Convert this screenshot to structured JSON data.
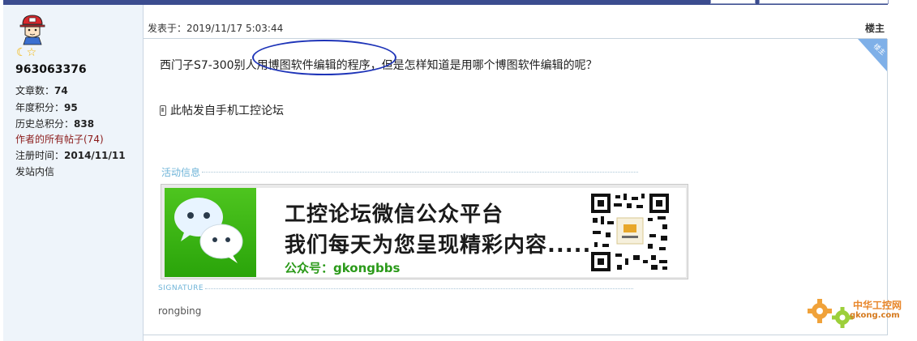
{
  "user": {
    "name": "963063376",
    "stats": [
      {
        "label": "文章数：",
        "value": "74"
      },
      {
        "label": "年度积分：",
        "value": "95"
      },
      {
        "label": "历史总积分：",
        "value": "838"
      }
    ],
    "all_posts_link": "作者的所有帖子(74)",
    "register": {
      "label": "注册时间：",
      "value": "2014/11/11"
    },
    "message_link": "发站内信"
  },
  "post": {
    "time": "发表于：2019/11/17 5:03:44",
    "floor": "楼主",
    "corner_label": "楼主",
    "text": "西门子S7-300别人用博图软件编辑的程序，但是怎样知道是用哪个博图软件编辑的呢？",
    "mobile_note": "此帖发自手机工控论坛"
  },
  "activity": {
    "label": "活动信息",
    "banner_line1": "工控论坛微信公众平台",
    "banner_line2": "我们每天为您呈现精彩内容......",
    "banner_line3": "公众号：gkongbbs"
  },
  "signature": {
    "label": "SIGNATURE",
    "text": "rongbing"
  },
  "watermark": {
    "cn": "中华工控网",
    "en": "gkong.com"
  },
  "colors": {
    "topbar": "#3b4c8f",
    "sidebar_bg": "#eef4fa",
    "section_label": "#6fb4d8",
    "wechat_green": "#3ab515",
    "circle": "#1e34b8"
  }
}
